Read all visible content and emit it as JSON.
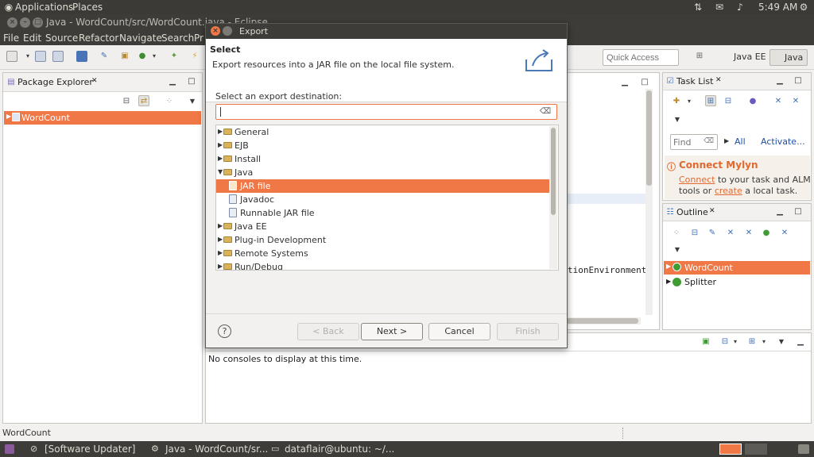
{
  "top_panel": {
    "applications": "Applications",
    "places": "Places",
    "clock": "5:49 AM"
  },
  "window": {
    "title": "Java - WordCount/src/WordCount.java - Eclipse"
  },
  "menu": [
    "File",
    "Edit",
    "Source",
    "Refactor",
    "Navigate",
    "Search",
    "Pr"
  ],
  "toolbar": {
    "quick_access_placeholder": "Quick Access",
    "perspective_java_ee": "Java EE",
    "perspective_java": "Java"
  },
  "package_explorer": {
    "title": "Package Explorer",
    "close": "✕",
    "items": [
      {
        "label": "WordCount"
      }
    ]
  },
  "editor": {
    "visible_code": "tionEnvironment("
  },
  "task_list": {
    "title": "Task List",
    "find_placeholder": "Find",
    "all_link": "All",
    "activate_link": "Activate...",
    "mylyn_title": "Connect Mylyn",
    "mylyn_connect": "Connect",
    "mylyn_text1": " to your task and ALM",
    "mylyn_text2": "tools or ",
    "mylyn_create": "create",
    "mylyn_text3": " a local task."
  },
  "outline": {
    "title": "Outline",
    "items": [
      {
        "label": "WordCount"
      },
      {
        "label": "Splitter"
      }
    ]
  },
  "console": {
    "message": "No consoles to display at this time."
  },
  "status_bar": {
    "text": "WordCount"
  },
  "dialog": {
    "title": "Export",
    "heading": "Select",
    "description": "Export resources into a JAR file on the local file system.",
    "dest_label": "Select an export destination:",
    "dest_value": "",
    "tree": [
      {
        "label": "General"
      },
      {
        "label": "EJB"
      },
      {
        "label": "Install"
      },
      {
        "label": "Java"
      },
      {
        "label": "JAR file"
      },
      {
        "label": "Javadoc"
      },
      {
        "label": "Runnable JAR file"
      },
      {
        "label": "Java EE"
      },
      {
        "label": "Plug-in Development"
      },
      {
        "label": "Remote Systems"
      },
      {
        "label": "Run/Debug"
      }
    ],
    "buttons": {
      "back": "< Back",
      "next": "Next >",
      "cancel": "Cancel",
      "finish": "Finish"
    }
  },
  "taskbar": {
    "items": [
      {
        "label": "[Software Updater]"
      },
      {
        "label": "Java - WordCount/sr..."
      },
      {
        "label": "dataflair@ubuntu: ~/..."
      }
    ]
  },
  "colors": {
    "accent": "#f07746",
    "panel_dark": "#3d3c38",
    "mylyn_title": "#e0692f"
  }
}
